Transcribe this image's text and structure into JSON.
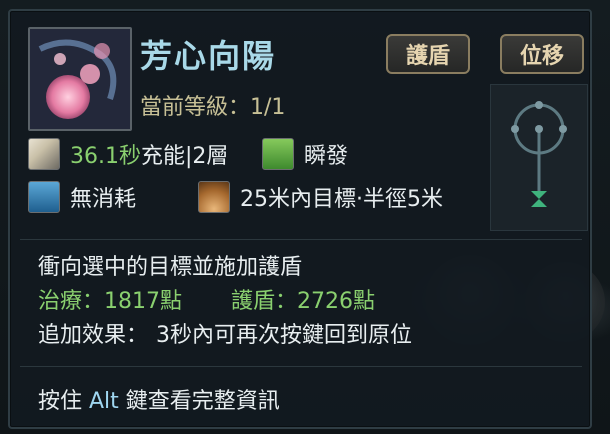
{
  "skill": {
    "name": "芳心向陽",
    "level_label": "當前等級：",
    "level_value": "1/1",
    "icon": "pink-flower-skill-icon"
  },
  "tags": [
    "護盾",
    "位移"
  ],
  "stats": {
    "cooldown_value": "36.1秒",
    "cooldown_suffix": "充能|2層",
    "cast_type": "瞬發",
    "cost": "無消耗",
    "range": "25米內目標·半徑5米"
  },
  "description": {
    "line1": "衝向選中的目標並施加護盾",
    "heal_label": "治療：",
    "heal_value": "1817點",
    "shield_label": "護盾：",
    "shield_value": "2726點",
    "extra_label": "追加效果：",
    "extra_value": "3秒內可再次按鍵回到原位"
  },
  "footer": {
    "prefix": "按住 ",
    "key": "Alt",
    "suffix": " 鍵查看完整資訊"
  },
  "colors": {
    "name": "#a9d9e8",
    "level": "#c7c096",
    "green": "#8ad06f",
    "tag_border": "#8a7d60"
  }
}
